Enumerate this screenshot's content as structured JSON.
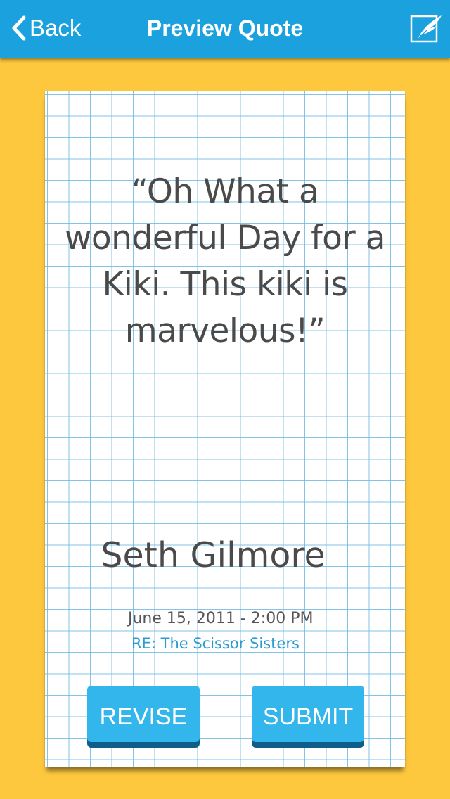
{
  "nav": {
    "back_label": "Back",
    "title": "Preview Quote",
    "compose_icon": "quill-compose-icon"
  },
  "quote": {
    "text": "“Oh What a wonderful Day for a Kiki.  This kiki is marvelous!”",
    "author": "Seth Gilmore",
    "datetime": "June 15, 2011 - 2:00 PM",
    "re": "RE: The Scissor Sisters"
  },
  "actions": {
    "revise_label": "REVISE",
    "submit_label": "SUBMIT"
  },
  "colors": {
    "navbar": "#1BA1DD",
    "background": "#FDC83D",
    "button": "#33B6EC",
    "button_shadow": "#0F5E8A",
    "grid": "#6EB9E1",
    "text": "#4A4A4A",
    "link": "#2A9BD3"
  }
}
